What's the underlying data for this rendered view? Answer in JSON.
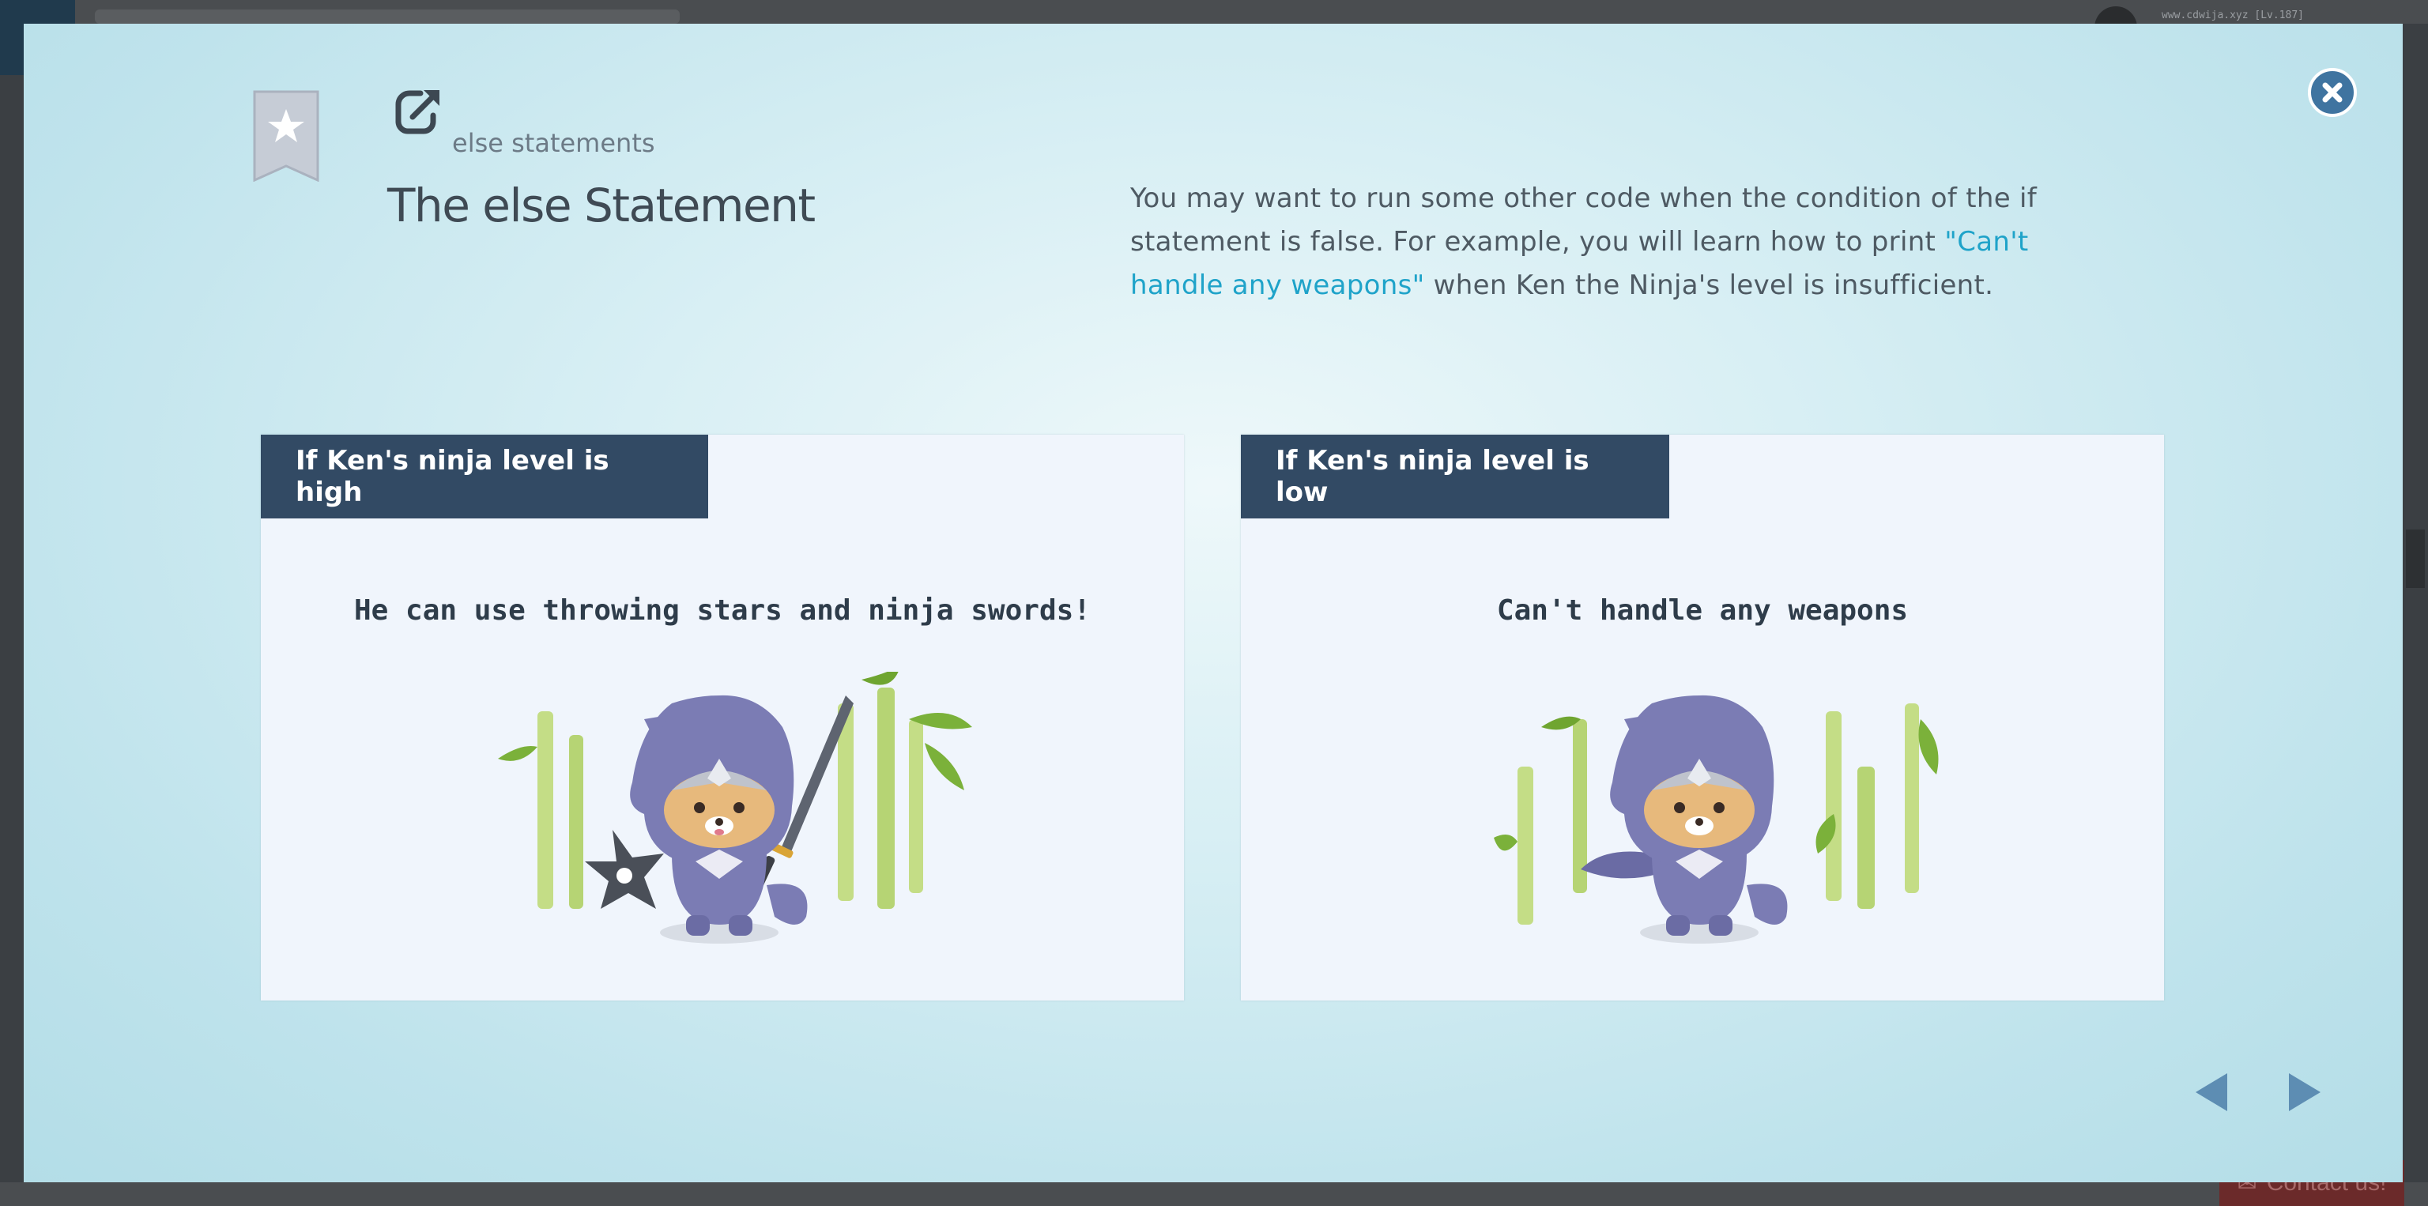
{
  "background": {
    "url_text": "www.cdwija.xyz [Lv.187]",
    "contact_label": "Contact us!"
  },
  "modal": {
    "breadcrumb": "else statements",
    "title": "The else Statement",
    "description": {
      "part1": "You may want to run some other code when the condition of the if statement is false. For example, you will learn how to print ",
      "highlight": "\"Can't handle any weapons\"",
      "part2": " when Ken the Ninja's level is insufficient."
    },
    "accent_color": "#1fa3c9",
    "cards": [
      {
        "tag": "If Ken's ninja level is high",
        "caption": "He can use throwing stars and ninja swords!"
      },
      {
        "tag": "If Ken's ninja level is low",
        "caption": "Can't handle any weapons"
      }
    ],
    "icons": {
      "close": "close-icon",
      "bookmark": "bookmark-star-icon",
      "external_link": "external-link-icon",
      "prev": "triangle-left-icon",
      "next": "triangle-right-icon"
    }
  }
}
